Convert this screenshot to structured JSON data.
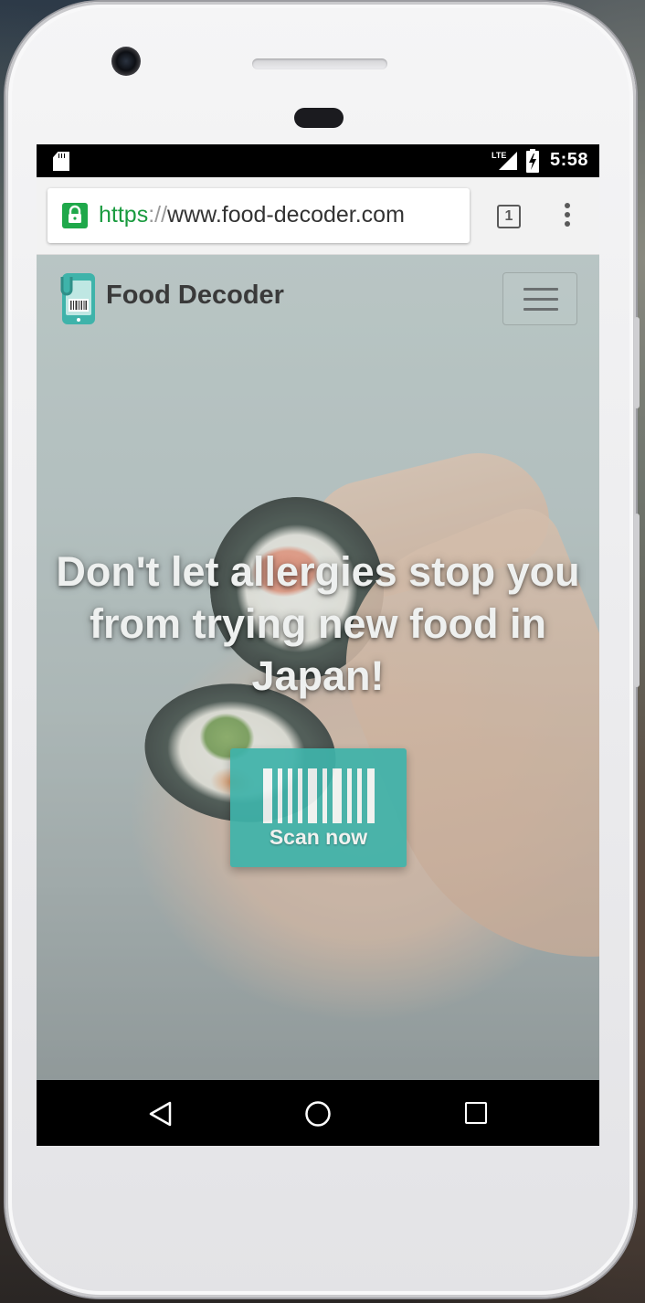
{
  "status_bar": {
    "time": "5:58",
    "network_label": "LTE",
    "icons": [
      "sd-card-icon",
      "lte-signal-icon",
      "battery-charging-icon"
    ]
  },
  "browser": {
    "url_scheme": "https",
    "url_separator": "://",
    "url_host": "www.food-decoder.com",
    "tab_count": "1",
    "icons": [
      "lock-icon",
      "tab-switcher-icon",
      "overflow-menu-icon"
    ]
  },
  "site": {
    "brand_name": "Food Decoder",
    "hero_title": "Don't let allergies stop you from trying new food in Japan!",
    "scan_button_label": "Scan now",
    "accent_color": "#3fb3aa",
    "icons": [
      "food-decoder-logo-icon",
      "hamburger-menu-icon",
      "barcode-icon"
    ]
  },
  "android_nav": {
    "icons": [
      "back-icon",
      "home-icon",
      "recents-icon"
    ]
  }
}
